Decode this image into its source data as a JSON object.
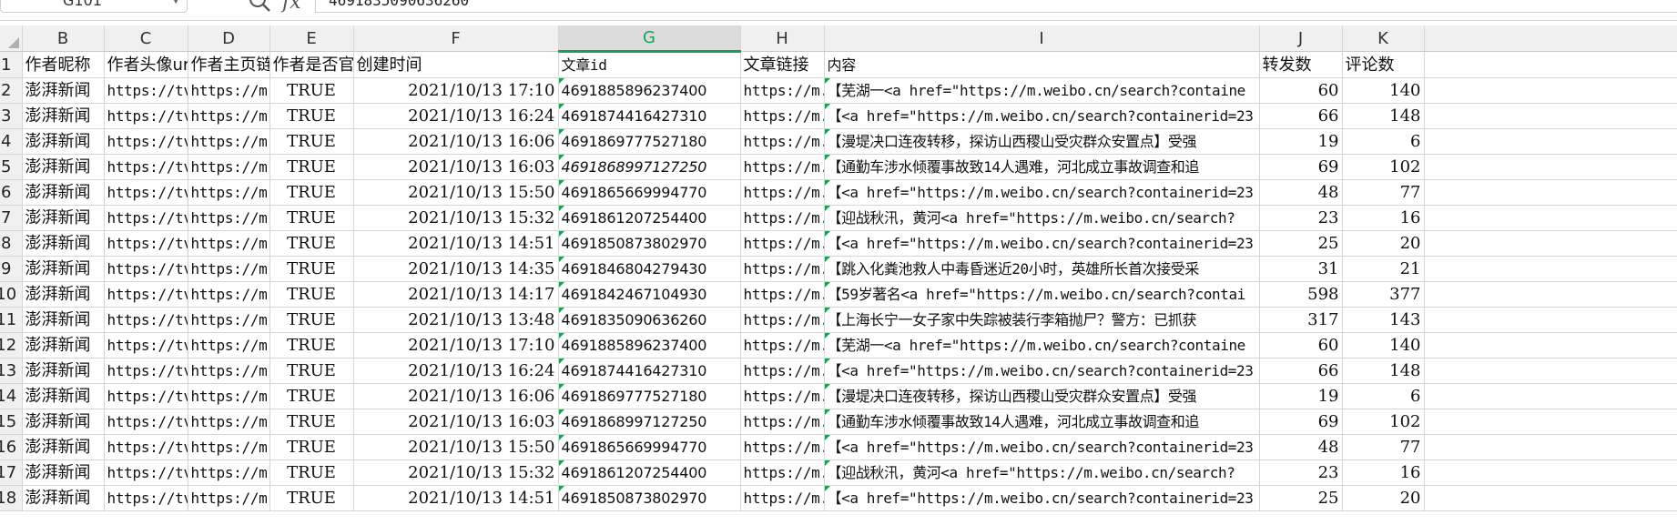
{
  "formula_bar": {
    "cell_ref": "G101",
    "value": "4691835090636260",
    "fx_label": "fx",
    "icons": {
      "zoom": "zoom-icon",
      "dropdown": "chevron-down-icon"
    }
  },
  "columns": [
    "B",
    "C",
    "D",
    "E",
    "F",
    "G",
    "H",
    "I",
    "J",
    "K"
  ],
  "selected_column": "G",
  "accent_color": "#18a058",
  "rows": [
    {
      "num": "1",
      "cells": [
        "作者昵称",
        "作者头像url",
        "作者主页链接",
        "作者是否官方认证",
        "创建时间",
        "文章id",
        "文章链接",
        "内容",
        "转发数",
        "评论数"
      ]
    },
    {
      "num": "2",
      "cells": [
        "澎湃新闻",
        "https://tvax",
        "https://m.",
        "TRUE",
        "2021/10/13 17:10",
        "4691885896237400",
        "https://m.",
        "【芜湖一<a  href=\"https://m.weibo.cn/search?containe",
        "60",
        "140"
      ]
    },
    {
      "num": "3",
      "cells": [
        "澎湃新闻",
        "https://tvax",
        "https://m.",
        "TRUE",
        "2021/10/13 16:24",
        "4691874416427310",
        "https://m.",
        "【<a  href=\"https://m.weibo.cn/search?containerid=23",
        "66",
        "148"
      ]
    },
    {
      "num": "4",
      "cells": [
        "澎湃新闻",
        "https://tvax",
        "https://m.",
        "TRUE",
        "2021/10/13 16:06",
        "4691869777527180",
        "https://m.",
        "【漫堤决口连夜转移，探访山西稷山受灾群众安置点】受强",
        "19",
        "6"
      ]
    },
    {
      "num": "5",
      "cells": [
        "澎湃新闻",
        "https://tvax",
        "https://m.",
        "TRUE",
        "2021/10/13 16:03",
        "4691868997127250",
        "https://m.",
        "【通勤车涉水倾覆事故致14人遇难，河北成立事故调查和追",
        "69",
        "102"
      ]
    },
    {
      "num": "6",
      "cells": [
        "澎湃新闻",
        "https://tvax",
        "https://m.",
        "TRUE",
        "2021/10/13 15:50",
        "4691865669994770",
        "https://m.",
        "【<a  href=\"https://m.weibo.cn/search?containerid=23",
        "48",
        "77"
      ]
    },
    {
      "num": "7",
      "cells": [
        "澎湃新闻",
        "https://tvax",
        "https://m.",
        "TRUE",
        "2021/10/13 15:32",
        "4691861207254400",
        "https://m.",
        "【迎战秋汛，黄河<a  href=\"https://m.weibo.cn/search?",
        "23",
        "16"
      ]
    },
    {
      "num": "8",
      "cells": [
        "澎湃新闻",
        "https://tvax",
        "https://m.",
        "TRUE",
        "2021/10/13 14:51",
        "4691850873802970",
        "https://m.",
        "【<a  href=\"https://m.weibo.cn/search?containerid=23",
        "25",
        "20"
      ]
    },
    {
      "num": "9",
      "cells": [
        "澎湃新闻",
        "https://tvax",
        "https://m.",
        "TRUE",
        "2021/10/13 14:35",
        "4691846804279430",
        "https://m.",
        "【跳入化粪池救人中毒昏迷近20小时，英雄所长首次接受采",
        "31",
        "21"
      ]
    },
    {
      "num": "10",
      "cells": [
        "澎湃新闻",
        "https://tvax",
        "https://m.",
        "TRUE",
        "2021/10/13 14:17",
        "4691842467104930",
        "https://m.",
        "【59岁著名<a  href=\"https://m.weibo.cn/search?contai",
        "598",
        "377"
      ]
    },
    {
      "num": "11",
      "cells": [
        "澎湃新闻",
        "https://tvax",
        "https://m.",
        "TRUE",
        "2021/10/13 13:48",
        "4691835090636260",
        "https://m.",
        "【上海长宁一女子家中失踪被装行李箱抛尸？警方：已抓获",
        "317",
        "143"
      ]
    },
    {
      "num": "12",
      "cells": [
        "澎湃新闻",
        "https://tvax",
        "https://m.",
        "TRUE",
        "2021/10/13 17:10",
        "4691885896237400",
        "https://m.",
        "【芜湖一<a  href=\"https://m.weibo.cn/search?containe",
        "60",
        "140"
      ]
    },
    {
      "num": "13",
      "cells": [
        "澎湃新闻",
        "https://tvax",
        "https://m.",
        "TRUE",
        "2021/10/13 16:24",
        "4691874416427310",
        "https://m.",
        "【<a  href=\"https://m.weibo.cn/search?containerid=23",
        "66",
        "148"
      ]
    },
    {
      "num": "14",
      "cells": [
        "澎湃新闻",
        "https://tvax",
        "https://m.",
        "TRUE",
        "2021/10/13 16:06",
        "4691869777527180",
        "https://m.",
        "【漫堤决口连夜转移，探访山西稷山受灾群众安置点】受强",
        "19",
        "6"
      ]
    },
    {
      "num": "15",
      "cells": [
        "澎湃新闻",
        "https://tvax",
        "https://m.",
        "TRUE",
        "2021/10/13 16:03",
        "4691868997127250",
        "https://m.",
        "【通勤车涉水倾覆事故致14人遇难，河北成立事故调查和追",
        "69",
        "102"
      ]
    },
    {
      "num": "16",
      "cells": [
        "澎湃新闻",
        "https://tvax",
        "https://m.",
        "TRUE",
        "2021/10/13 15:50",
        "4691865669994770",
        "https://m.",
        "【<a  href=\"https://m.weibo.cn/search?containerid=23",
        "48",
        "77"
      ]
    },
    {
      "num": "17",
      "cells": [
        "澎湃新闻",
        "https://tvax",
        "https://m.",
        "TRUE",
        "2021/10/13 15:32",
        "4691861207254400",
        "https://m.",
        "【迎战秋汛，黄河<a  href=\"https://m.weibo.cn/search?",
        "23",
        "16"
      ]
    },
    {
      "num": "18",
      "cells": [
        "澎湃新闻",
        "https://tvax",
        "https://m.",
        "TRUE",
        "2021/10/13 14:51",
        "4691850873802970",
        "https://m.",
        "【<a  href=\"https://m.weibo.cn/search?containerid=23",
        "25",
        "20"
      ]
    }
  ]
}
